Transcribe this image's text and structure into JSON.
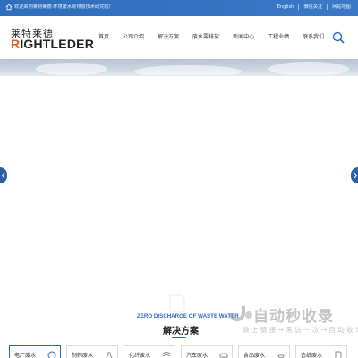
{
  "topbar": {
    "welcome": "欢迎来到莱特莱德-环境废水零排放技术研究院！",
    "links": [
      "English",
      "微信关注",
      "网站地图"
    ],
    "colors": {
      "bar": "#3470c0"
    }
  },
  "header": {
    "logo_cn": "莱特莱德",
    "logo_en_r": "R",
    "logo_en_rest": "IGHTLEDER",
    "nav": [
      "首页",
      "公司介绍",
      "解决方案",
      "废水零排放",
      "新闻中心",
      "工程业绩",
      "联系我们"
    ],
    "search_icon": "search-icon"
  },
  "banner": {
    "arrow_left_icon": "chevron-left-icon",
    "arrow_right_icon": "chevron-right-icon"
  },
  "solutions": {
    "title_en": "ZERO DISCHARGE OF WASTE WATER",
    "title_cn": "解决方案",
    "tabs": [
      "电厂废水",
      "制药废水",
      "化纤废水",
      "汽车废水",
      "食品废水",
      "造纸废水"
    ]
  },
  "watermark": {
    "text": "自动秒收录",
    "sub": "做 上 链 接 → 来 访 一 次 → 自 动 收 录"
  },
  "colors": {
    "accent": "#2e6bc0",
    "logo_r": "#e25d2a"
  }
}
